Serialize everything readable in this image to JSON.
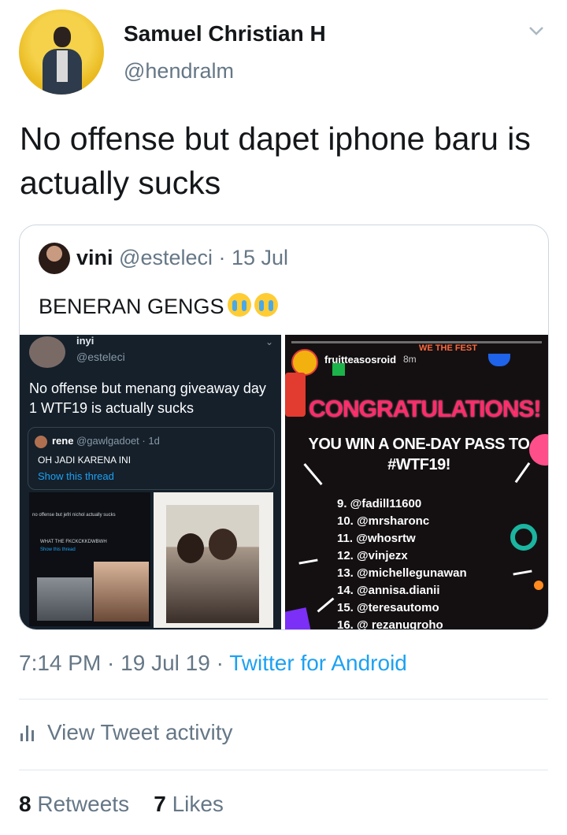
{
  "author": {
    "name": "Samuel Christian H",
    "handle": "@hendralm"
  },
  "tweet": {
    "text": "No offense but dapet iphone baru is actually sucks"
  },
  "quoted": {
    "name": "vini",
    "handle": "@esteleci",
    "date": "· 15 Jul",
    "text": "BENERAN GENGS",
    "emoji": "loudly-crying-face-icon",
    "media_left": {
      "name": "inyi",
      "handle": "@esteleci",
      "text": "No offense but menang giveaway day 1 WTF19 is actually sucks",
      "quote_name": "rene",
      "quote_handle": "@gawlgadoet · 1d",
      "quote_text": "OH JADI KARENA INI",
      "quote_link": "Show this thread",
      "tiny_1": "no offense but jefri nichol actually sucks",
      "tiny_2": "WHAT THE FKCKCKKDWBWH",
      "tiny_3": "Show this thread"
    },
    "media_right": {
      "account": "fruitteasosroid",
      "time": "8m",
      "fest": "WE THE FEST",
      "headline": "CONGRATULATIONS!",
      "win_line1": "YOU WIN A ONE-DAY PASS TO",
      "win_line2": "#WTF19!",
      "winners": [
        "9. @fadill11600",
        "10. @mrsharonc",
        "11. @whosrtw",
        "12. @vinjezx",
        "13. @michellegunawan",
        "14. @annisa.dianii",
        "15. @teresautomo",
        "16. @ rezanugroho"
      ]
    }
  },
  "meta": {
    "time": "7:14 PM",
    "date": "19 Jul 19",
    "source": "Twitter for Android"
  },
  "activity": {
    "label": "View Tweet activity"
  },
  "stats": {
    "retweets": "8",
    "retweets_label": "Retweets",
    "likes": "7",
    "likes_label": "Likes"
  },
  "colors": {
    "link": "#1da1f2",
    "muted": "#657786",
    "text": "#14171a",
    "congrats": "#ff2c6b"
  }
}
